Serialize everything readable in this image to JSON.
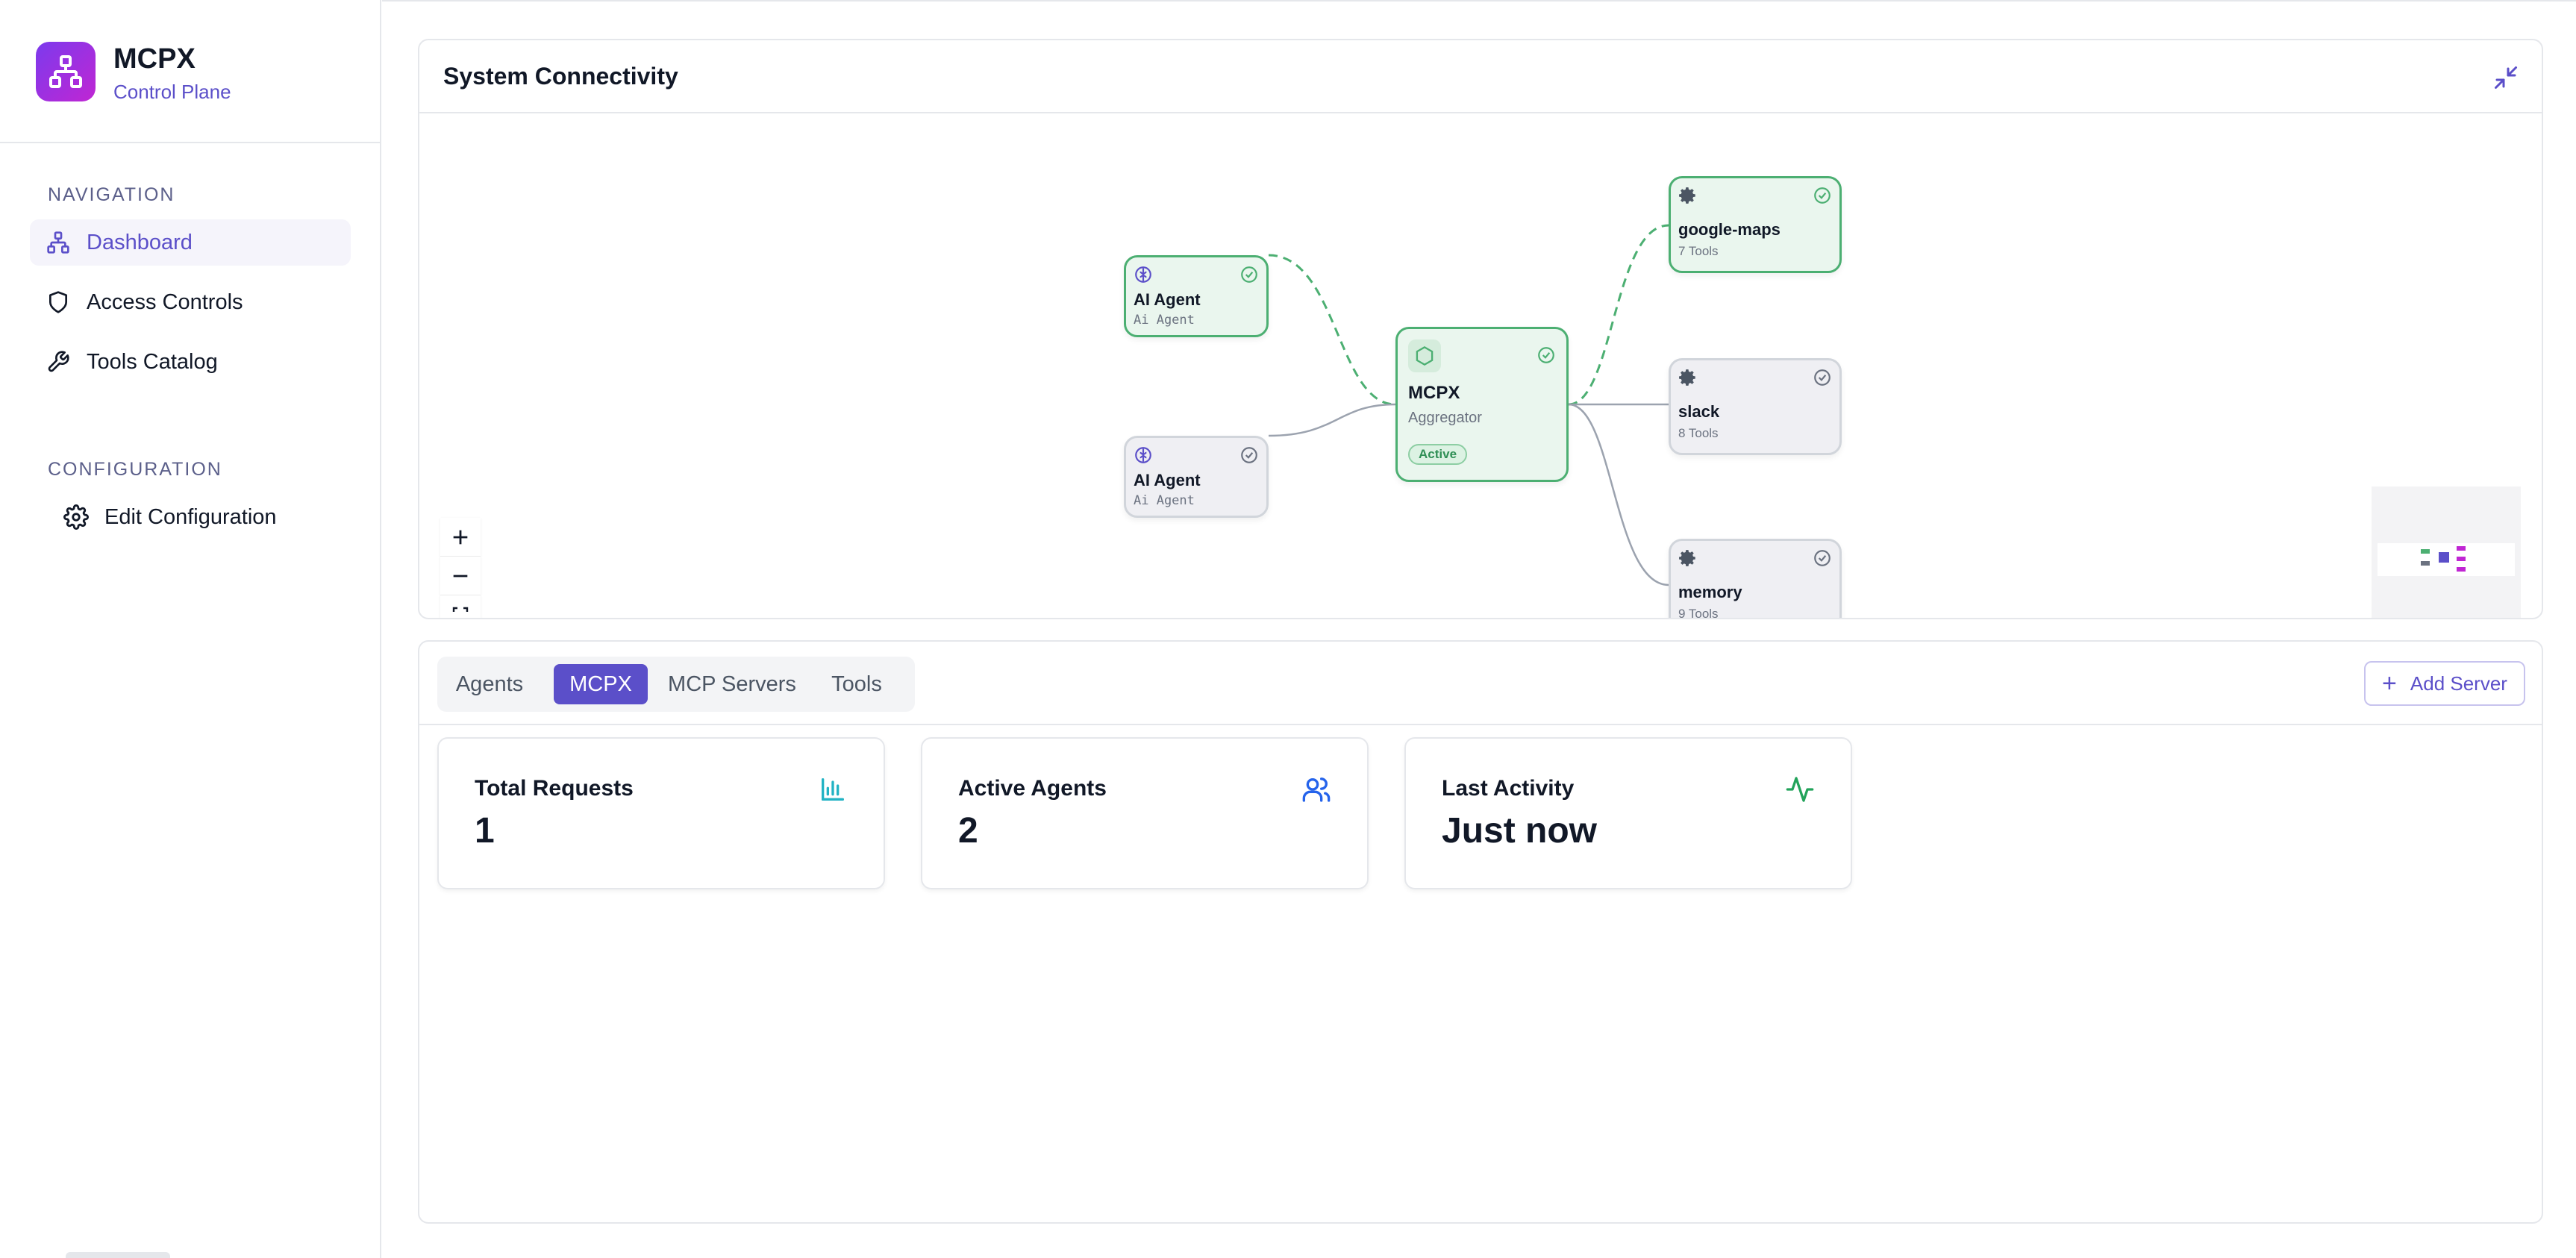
{
  "app": {
    "name": "MCPX",
    "subtitle": "Control Plane"
  },
  "nav": {
    "section1": "NAVIGATION",
    "items": [
      {
        "label": "Dashboard",
        "icon": "network-icon",
        "active": true
      },
      {
        "label": "Access Controls",
        "icon": "shield-icon",
        "active": false
      },
      {
        "label": "Tools Catalog",
        "icon": "wrench-icon",
        "active": false
      }
    ],
    "section2": "CONFIGURATION",
    "config_items": [
      {
        "label": "Edit Configuration",
        "icon": "gear-icon"
      }
    ]
  },
  "connectivity": {
    "title": "System Connectivity",
    "agents": [
      {
        "title": "AI Agent",
        "subtitle": "Ai Agent",
        "status": "active"
      },
      {
        "title": "AI Agent",
        "subtitle": "Ai Agent",
        "status": "idle"
      }
    ],
    "hub": {
      "title": "MCPX",
      "subtitle": "Aggregator",
      "badge": "Active"
    },
    "servers": [
      {
        "title": "google-maps",
        "tools": "7 Tools",
        "status": "active"
      },
      {
        "title": "slack",
        "tools": "8 Tools",
        "status": "idle"
      },
      {
        "title": "memory",
        "tools": "9 Tools",
        "status": "idle"
      }
    ],
    "controls": [
      "zoom-in",
      "zoom-out",
      "fit-view"
    ]
  },
  "tabs": {
    "items": [
      "Agents",
      "MCPX",
      "MCP Servers",
      "Tools"
    ],
    "active": "MCPX",
    "add_button": "Add Server"
  },
  "stats": [
    {
      "label": "Total Requests",
      "value": "1",
      "icon": "bar-chart-icon"
    },
    {
      "label": "Active Agents",
      "value": "2",
      "icon": "users-icon"
    },
    {
      "label": "Last Activity",
      "value": "Just now",
      "icon": "activity-icon"
    }
  ],
  "colors": {
    "accent": "#5b4fc9",
    "success": "#4caf72",
    "logo_gradient_start": "#7c3aed",
    "logo_gradient_end": "#c026d3"
  }
}
